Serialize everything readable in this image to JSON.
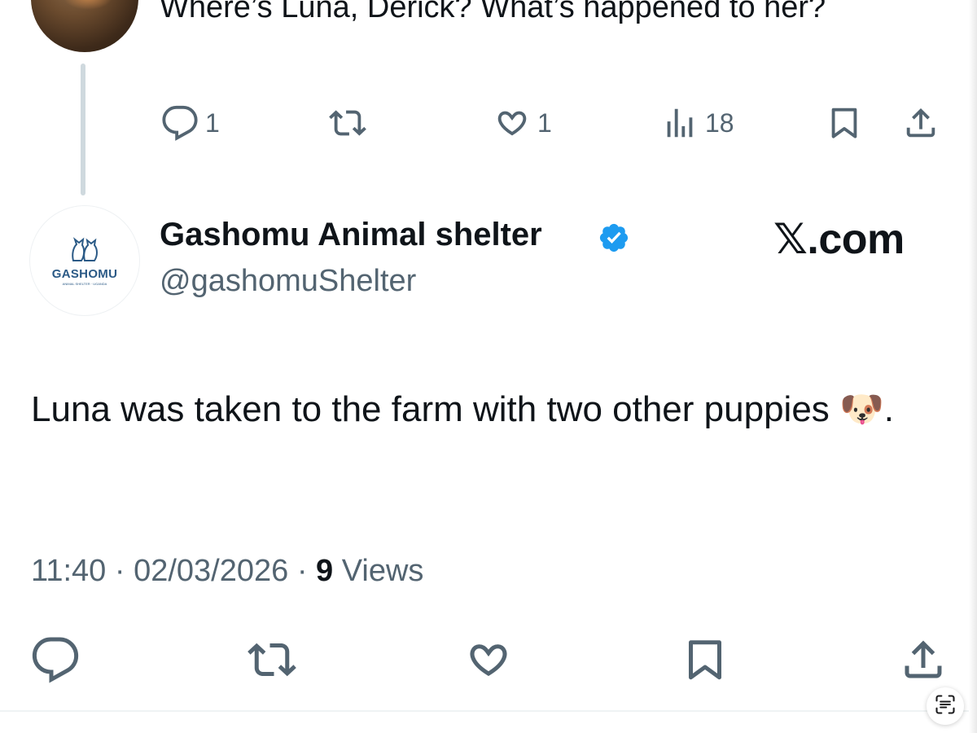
{
  "parent_tweet": {
    "text": "Where’s Luna, Derick? What’s happened to her?",
    "actions": {
      "reply_count": "1",
      "like_count": "1",
      "view_count": "18"
    }
  },
  "reply_tweet": {
    "display_name": "Gashomu Animal shelter",
    "handle": "@gashomuShelter",
    "avatar_logo_text": "GASHOMU",
    "avatar_logo_subtext": "ANIMAL SHELTER · UGANDA",
    "watermark": "𝕏.com",
    "text": "Luna was taken to the farm with two other puppies 🐶.",
    "time": "11:40",
    "date": "02/03/2026",
    "views_count": "9",
    "views_label": "Views",
    "separator": "·"
  },
  "colors": {
    "text_primary": "#0f1419",
    "text_secondary": "#536471",
    "verified_blue": "#1d9bf0",
    "thread_line": "#cfd9de"
  },
  "icons": [
    "reply-icon",
    "retweet-icon",
    "like-icon",
    "views-icon",
    "bookmark-icon",
    "share-icon",
    "verified-badge-icon",
    "scan-text-icon"
  ]
}
